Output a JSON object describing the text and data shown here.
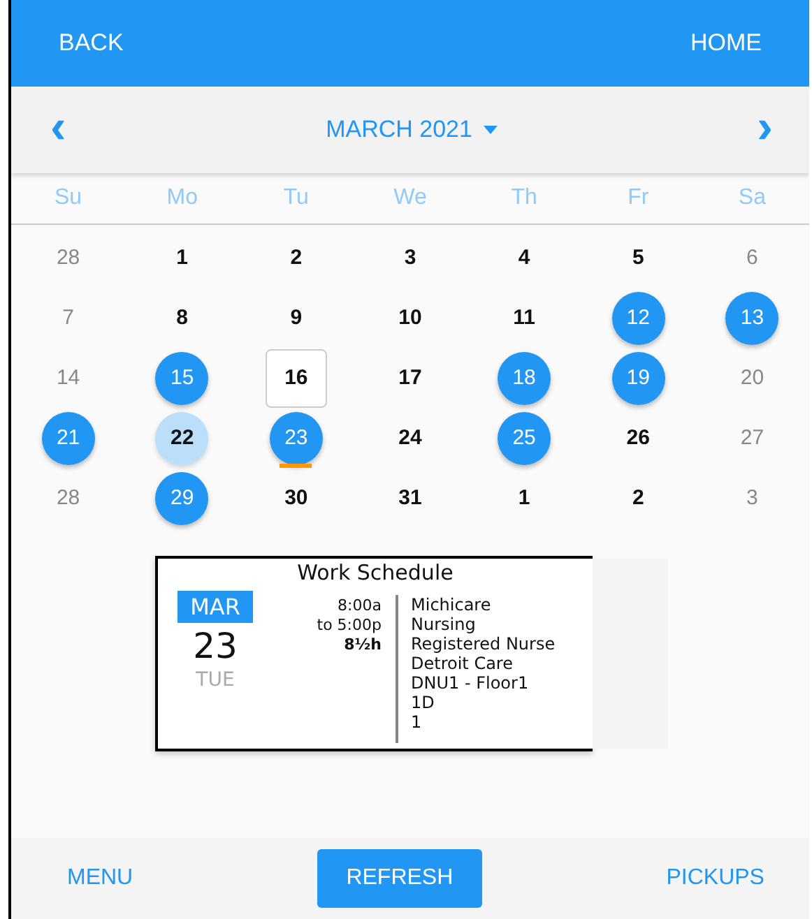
{
  "top_bar": {
    "back": "BACK",
    "home": "HOME"
  },
  "month_nav": {
    "prev": "‹",
    "title": "MARCH 2021",
    "next": "›"
  },
  "weekdays": [
    "Su",
    "Mo",
    "Tu",
    "We",
    "Th",
    "Fr",
    "Sa"
  ],
  "days": [
    {
      "label": "28",
      "kind": "outside",
      "marked": false
    },
    {
      "label": "1",
      "kind": "plain",
      "marked": false
    },
    {
      "label": "2",
      "kind": "plain",
      "marked": false
    },
    {
      "label": "3",
      "kind": "plain",
      "marked": false
    },
    {
      "label": "4",
      "kind": "plain",
      "marked": false
    },
    {
      "label": "5",
      "kind": "plain",
      "marked": false
    },
    {
      "label": "6",
      "kind": "weekend",
      "marked": false
    },
    {
      "label": "7",
      "kind": "weekend",
      "marked": false
    },
    {
      "label": "8",
      "kind": "plain",
      "marked": false
    },
    {
      "label": "9",
      "kind": "plain",
      "marked": false
    },
    {
      "label": "10",
      "kind": "plain",
      "marked": false
    },
    {
      "label": "11",
      "kind": "plain",
      "marked": false
    },
    {
      "label": "12",
      "kind": "shift",
      "marked": false
    },
    {
      "label": "13",
      "kind": "shift",
      "marked": false
    },
    {
      "label": "14",
      "kind": "weekend",
      "marked": false
    },
    {
      "label": "15",
      "kind": "shift",
      "marked": false
    },
    {
      "label": "16",
      "kind": "today",
      "marked": false
    },
    {
      "label": "17",
      "kind": "plain",
      "marked": false
    },
    {
      "label": "18",
      "kind": "shift",
      "marked": false
    },
    {
      "label": "19",
      "kind": "shift",
      "marked": false
    },
    {
      "label": "20",
      "kind": "weekend",
      "marked": false
    },
    {
      "label": "21",
      "kind": "shift",
      "marked": false
    },
    {
      "label": "22",
      "kind": "picked",
      "marked": false
    },
    {
      "label": "23",
      "kind": "shift",
      "marked": true
    },
    {
      "label": "24",
      "kind": "plain",
      "marked": false
    },
    {
      "label": "25",
      "kind": "shift",
      "marked": false
    },
    {
      "label": "26",
      "kind": "plain",
      "marked": false
    },
    {
      "label": "27",
      "kind": "weekend",
      "marked": false
    },
    {
      "label": "28",
      "kind": "weekend",
      "marked": false
    },
    {
      "label": "29",
      "kind": "shift",
      "marked": false
    },
    {
      "label": "30",
      "kind": "plain",
      "marked": false
    },
    {
      "label": "31",
      "kind": "plain",
      "marked": false
    },
    {
      "label": "1",
      "kind": "plain",
      "marked": false
    },
    {
      "label": "2",
      "kind": "plain",
      "marked": false
    },
    {
      "label": "3",
      "kind": "outside",
      "marked": false
    }
  ],
  "schedule_card": {
    "title": "Work Schedule",
    "month": "MAR",
    "day": "23",
    "weekday": "TUE",
    "start": "8:00a",
    "end": "to 5:00p",
    "hours": "8½h",
    "details": [
      "Michicare",
      "Nursing",
      "Registered Nurse",
      "Detroit Care",
      "DNU1 - Floor1",
      "1D",
      "1"
    ]
  },
  "bottom_bar": {
    "menu": "MENU",
    "refresh": "REFRESH",
    "pickups": "PICKUPS"
  }
}
